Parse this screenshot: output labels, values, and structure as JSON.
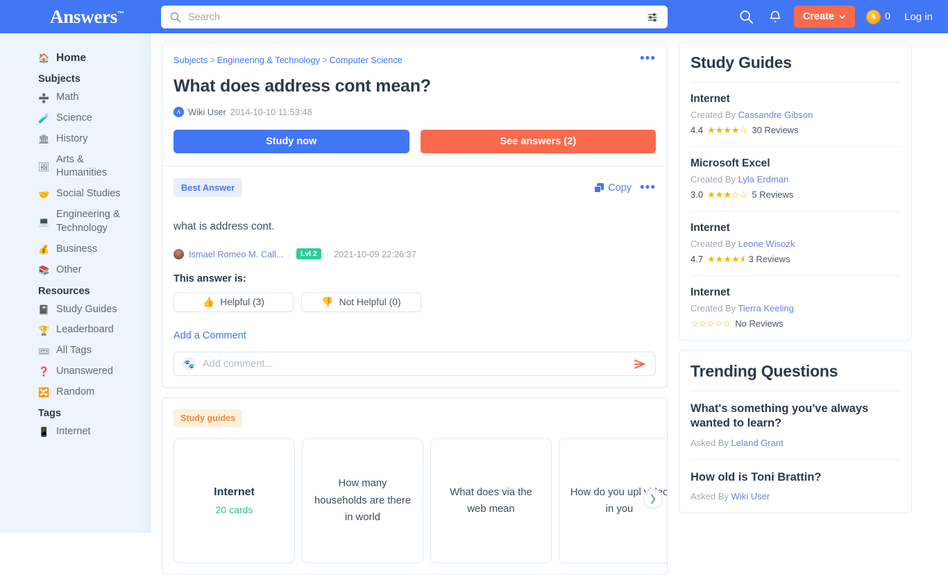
{
  "header": {
    "logo": "Answers",
    "logo_tm": "™",
    "search": {
      "placeholder": "Search",
      "value": ""
    },
    "search_icon": "search-icon",
    "filter_icon": "filter-sliders-icon",
    "magnifier_icon": "search-icon",
    "bell_icon": "notification-bell-icon",
    "create_label": "Create",
    "coin_letter": "A",
    "coin_count": "0",
    "login_label": "Log in"
  },
  "sidebar": {
    "home": {
      "label": "Home",
      "icon": "home-icon"
    },
    "subjects_heading": "Subjects",
    "subjects": [
      {
        "label": "Math",
        "icon": "divide-icon"
      },
      {
        "label": "Science",
        "icon": "test-tube-icon"
      },
      {
        "label": "History",
        "icon": "classical-building-icon"
      },
      {
        "label": "Arts & Humanities",
        "icon": "framed-picture-icon"
      },
      {
        "label": "Social Studies",
        "icon": "handshake-icon"
      },
      {
        "label": "Engineering & Technology",
        "icon": "laptop-icon"
      },
      {
        "label": "Business",
        "icon": "money-bag-icon"
      },
      {
        "label": "Other",
        "icon": "books-icon"
      }
    ],
    "resources_heading": "Resources",
    "resources": [
      {
        "label": "Study Guides",
        "icon": "notebook-icon"
      },
      {
        "label": "Leaderboard",
        "icon": "trophy-icon"
      },
      {
        "label": "All Tags",
        "icon": "admission-tickets-icon"
      },
      {
        "label": "Unanswered",
        "icon": "question-mark-icon"
      },
      {
        "label": "Random",
        "icon": "shuffle-icon"
      }
    ],
    "tags_heading": "Tags",
    "tags": [
      {
        "label": "Internet",
        "icon": "mobile-phone-icon"
      }
    ]
  },
  "question": {
    "breadcrumb": [
      "Subjects",
      "Engineering & Technology",
      "Computer Science"
    ],
    "breadcrumb_sep": ">",
    "more_icon": "more-options-icon",
    "title": "What does address cont mean?",
    "author": "Wiki User",
    "author_avatar_letter": "A",
    "date": "2014-10-10 11:53:48",
    "study_now_label": "Study now",
    "see_answers_label": "See answers (2)"
  },
  "answer": {
    "best_badge": "Best Answer",
    "copy_label": "Copy",
    "copy_icon": "copy-icon",
    "more_icon": "more-options-icon",
    "text": "what is address cont.",
    "author": "Ismael Romeo M. Call...",
    "meta_dot": "·",
    "level_badge": "Lvl 2",
    "date": "2021-10-09 22:26:37",
    "this_answer_is": "This answer is:",
    "helpful_label": "Helpful (3)",
    "helpful_icon": "thumbs-up-icon",
    "not_helpful_label": "Not Helpful (0)",
    "not_helpful_icon": "thumbs-down-icon",
    "add_comment_link": "Add a Comment",
    "comment_placeholder": "Add comment...",
    "comment_value": "",
    "send_icon": "send-arrow-icon"
  },
  "study_guides_carousel": {
    "tag": "Study guides",
    "next_icon": "chevron-right-icon",
    "items": [
      {
        "title": "Internet",
        "subtitle": "20 cards",
        "type": "guide"
      },
      {
        "title": "How many households are there in world",
        "type": "question"
      },
      {
        "title": "What does via the web mean",
        "type": "question"
      },
      {
        "title": "How do you upl video in you",
        "type": "question"
      }
    ]
  },
  "rail": {
    "study_guides": {
      "title": "Study Guides",
      "created_by_label": "Created By",
      "entries": [
        {
          "name": "Internet",
          "creator": "Cassandre Gibson",
          "score": "4.4",
          "stars": "★★★★☆",
          "reviews": "30 Reviews"
        },
        {
          "name": "Microsoft Excel",
          "creator": "Lyla Erdman",
          "score": "3.0",
          "stars": "★★★☆☆",
          "reviews": "5 Reviews"
        },
        {
          "name": "Internet",
          "creator": "Leone Wisozk",
          "score": "4.7",
          "stars": "★★★★⯨",
          "reviews": "3 Reviews"
        },
        {
          "name": "Internet",
          "creator": "Tierra Keeling",
          "score": "",
          "stars": "☆☆☆☆☆",
          "reviews": "No Reviews"
        }
      ]
    },
    "trending": {
      "title": "Trending Questions",
      "asked_by_label": "Asked By",
      "entries": [
        {
          "question": "What's something you've always wanted to learn?",
          "asker": "Leland Grant"
        },
        {
          "question": "How old is Toni Brattin?",
          "asker": "Wiki User"
        }
      ]
    }
  },
  "colors": {
    "brand_blue": "#4176f5",
    "accent_orange": "#f96a4d",
    "level_green": "#2ecc9b",
    "star_gold": "#f5b301",
    "sidebar_bg": "#eef4fb"
  }
}
